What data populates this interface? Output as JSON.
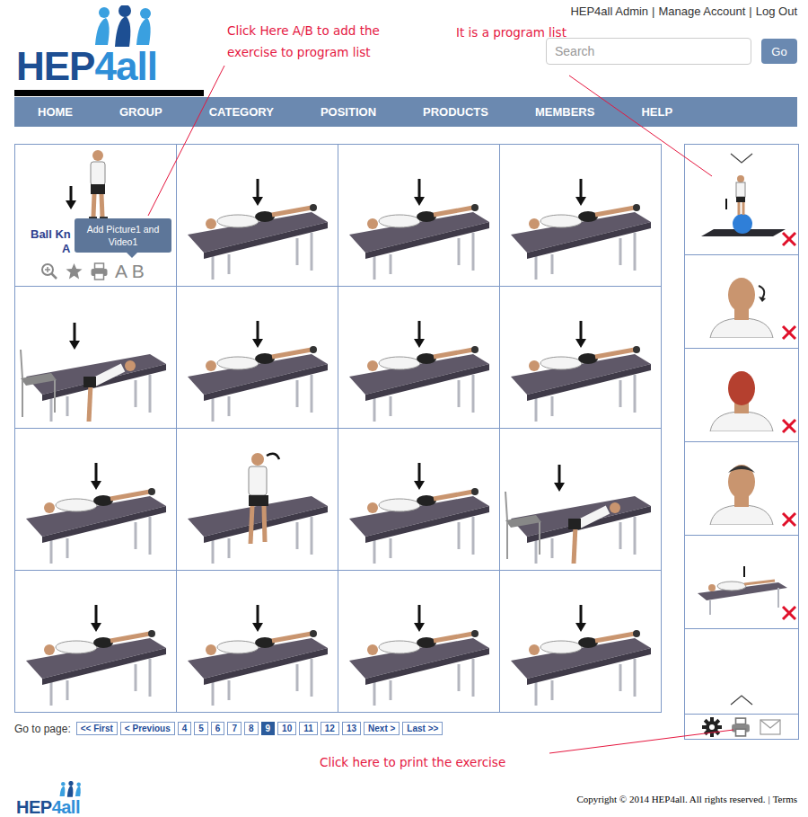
{
  "header": {
    "logo": [
      "HEP",
      "4all"
    ],
    "links": [
      "HEP4all Admin",
      "Manage Account",
      "Log Out"
    ],
    "separator": "|",
    "search": {
      "placeholder": "Search"
    },
    "go_button": "Go"
  },
  "nav": [
    {
      "label": "HOME",
      "selected": false
    },
    {
      "label": "GROUP",
      "selected": false
    },
    {
      "label": "CATEGORY",
      "selected": false
    },
    {
      "label": "POSITION",
      "selected": false
    },
    {
      "label": "PRODUCTS",
      "selected": false
    },
    {
      "label": "MEMBERS",
      "selected": false
    },
    {
      "label": "HELP",
      "selected": false
    }
  ],
  "exercises": [
    {
      "kind": "standing",
      "title_lines": [
        "Ball Kn",
        "A"
      ],
      "ab_label": "A B",
      "tooltip": "Add Picture1 and Video1"
    },
    {
      "kind": "table"
    },
    {
      "kind": "table"
    },
    {
      "kind": "table"
    },
    {
      "kind": "chair"
    },
    {
      "kind": "table"
    },
    {
      "kind": "table"
    },
    {
      "kind": "table"
    },
    {
      "kind": "table"
    },
    {
      "kind": "sitting"
    },
    {
      "kind": "table"
    },
    {
      "kind": "chair"
    },
    {
      "kind": "table"
    },
    {
      "kind": "table"
    },
    {
      "kind": "table"
    },
    {
      "kind": "table"
    }
  ],
  "program_list": {
    "items": [
      {
        "kind": "ball"
      },
      {
        "kind": "headturn"
      },
      {
        "kind": "muscles"
      },
      {
        "kind": "head"
      },
      {
        "kind": "table"
      }
    ]
  },
  "pagination": {
    "label": "Go to page:",
    "pages": [
      {
        "label": "<< First",
        "selected": false
      },
      {
        "label": "< Previous",
        "selected": false
      },
      {
        "label": "4",
        "selected": false
      },
      {
        "label": "5",
        "selected": false
      },
      {
        "label": "6",
        "selected": false
      },
      {
        "label": "7",
        "selected": false
      },
      {
        "label": "8",
        "selected": false
      },
      {
        "label": "9",
        "selected": true
      },
      {
        "label": "10",
        "selected": false
      },
      {
        "label": "11",
        "selected": false
      },
      {
        "label": "12",
        "selected": false
      },
      {
        "label": "13",
        "selected": false
      },
      {
        "label": "Next >",
        "selected": false
      },
      {
        "label": "Last >>",
        "selected": false
      }
    ]
  },
  "annotations": [
    {
      "lines": [
        "Click Here A/B to add the",
        "exercise to program list"
      ]
    },
    {
      "lines": [
        "It is a program list"
      ]
    },
    {
      "lines": [
        "Click here to print the exercise"
      ]
    }
  ],
  "footer": {
    "logo": [
      "HEP",
      "4all"
    ],
    "copyright": "Copyright © 2014 HEP4all. All rights reserved.",
    "separator": "|",
    "terms": "Terms"
  }
}
